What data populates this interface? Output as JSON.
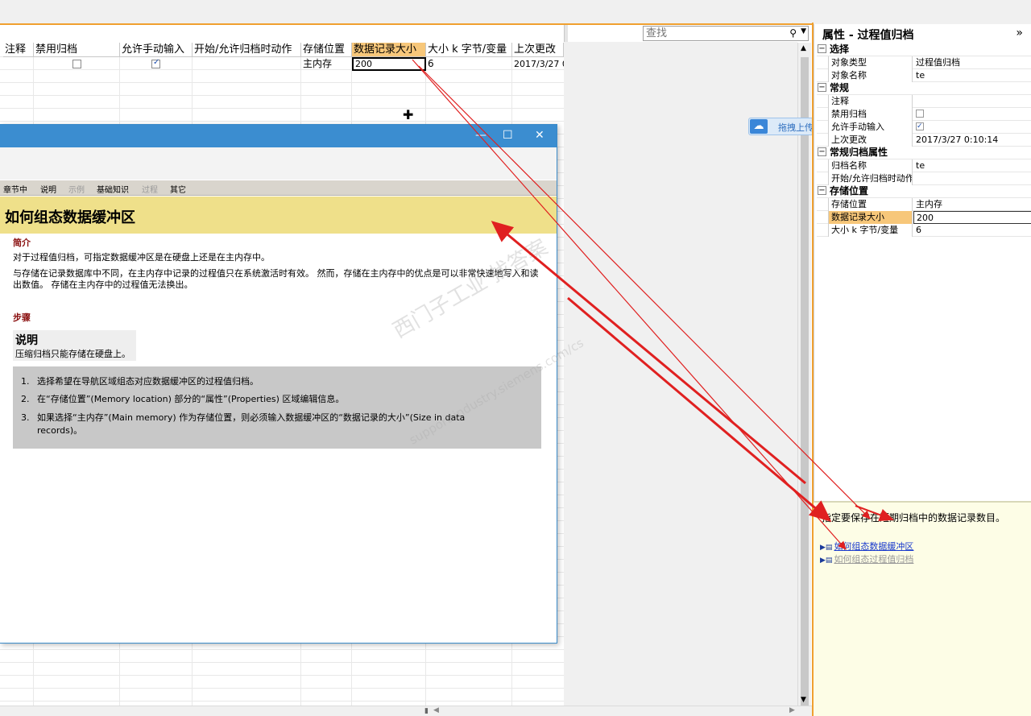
{
  "search": {
    "placeholder": "查找"
  },
  "table": {
    "columns": [
      "注释",
      "禁用归档",
      "允许手动输入",
      "开始/允许归档时动作",
      "存储位置",
      "数据记录大小",
      "大小 k 字节/变量",
      "上次更改"
    ],
    "row": {
      "note": "",
      "disable_archiving": false,
      "manual_input": true,
      "start_action": "",
      "storage": "主内存",
      "record_size": "200",
      "size_kb": "6",
      "last_change": "2017/3/27 0"
    }
  },
  "upload": {
    "label": "拖拽上传"
  },
  "properties": {
    "title": "属性 - 过程值归档",
    "more": "»",
    "groups": [
      {
        "name": "选择",
        "rows": [
          {
            "key": "对象类型",
            "value": "过程值归档"
          },
          {
            "key": "对象名称",
            "value": "te"
          }
        ]
      },
      {
        "name": "常规",
        "rows": [
          {
            "key": "注释",
            "value": ""
          },
          {
            "key": "禁用归档",
            "value": "",
            "checkbox": false
          },
          {
            "key": "允许手动输入",
            "value": "",
            "checkbox": true
          },
          {
            "key": "上次更改",
            "value": "2017/3/27 0:10:14"
          }
        ]
      },
      {
        "name": "常规归档属性",
        "rows": [
          {
            "key": "归档名称",
            "value": "te"
          },
          {
            "key": "开始/允许归档时动作",
            "value": ""
          }
        ]
      },
      {
        "name": "存储位置",
        "rows": [
          {
            "key": "存储位置",
            "value": "主内存"
          },
          {
            "key": "数据记录大小",
            "value": "200",
            "selected": true
          },
          {
            "key": "大小 k 字节/变量",
            "value": "6"
          }
        ]
      }
    ]
  },
  "help": {
    "text": "指定要保存在短期归档中的数据记录数目。",
    "links": [
      "如何组态数据缓冲区",
      "如何组态过程值归档"
    ]
  },
  "help_window": {
    "tabs": [
      "章节中",
      "说明",
      "示例",
      "基础知识",
      "过程",
      "其它"
    ],
    "heading": "如何组态数据缓冲区",
    "intro_title": "简介",
    "intro_p1": "对于过程值归档，可指定数据缓冲区是在硬盘上还是在主内存中。",
    "intro_p2": "与存储在记录数据库中不同，在主内存中记录的过程值只在系统激活时有效。 然而，存储在主内存中的优点是可以非常快速地写入和读出数值。 存储在主内存中的过程值无法换出。",
    "steps_title": "步骤",
    "note_title": "说明",
    "note_body": "压缩归档只能存储在硬盘上。",
    "steps": [
      "选择希望在导航区域组态对应数据缓冲区的过程值归档。",
      "在“存储位置”(Memory location) 部分的“属性”(Properties) 区域编辑信息。",
      "如果选择“主内存”(Main memory) 作为存储位置，则必须输入数据缓冲区的“数据记录的大小”(Size in data records)。"
    ],
    "window_controls": [
      "—",
      "☐",
      "✕"
    ]
  },
  "watermark": {
    "line1": "西门子工业  找答案",
    "line2": "support.industry.siemens.com/cs"
  },
  "colors": {
    "accent": "#f0a030",
    "title_bar": "#3b8dd0",
    "heading_bg": "#efe08a",
    "arrow": "#e02020"
  }
}
